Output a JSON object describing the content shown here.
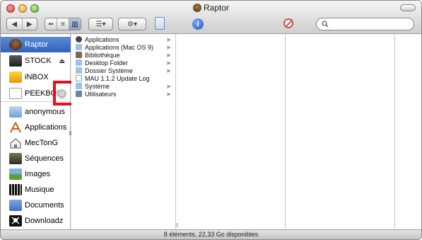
{
  "window": {
    "title": "Raptor"
  },
  "toolbar": {
    "back_icon": "back-arrow-icon",
    "forward_icon": "forward-arrow-icon",
    "view_icons": [
      "icon-view-icon",
      "list-view-icon",
      "column-view-icon"
    ],
    "arrange_icon": "arrange-menu-icon",
    "action_icon": "gear-action-icon",
    "search_value": ""
  },
  "sidebar": {
    "devices": [
      {
        "label": "Raptor",
        "selected": true
      },
      {
        "label": "STOCK",
        "eject": "⏏"
      },
      {
        "label": "iNBOX"
      },
      {
        "label": "PEEKBOX",
        "eject": "⊖"
      }
    ],
    "places": [
      {
        "label": "anonymous"
      },
      {
        "label": "Applications"
      },
      {
        "label": "MecTonG"
      },
      {
        "label": "Séquences"
      },
      {
        "label": "Images"
      },
      {
        "label": "Musique"
      },
      {
        "label": "Documents"
      },
      {
        "label": "Downloadz"
      }
    ]
  },
  "column1": {
    "items": [
      {
        "label": "Applications",
        "arrow": "▶"
      },
      {
        "label": "Applications (Mac OS 9)",
        "arrow": "▶"
      },
      {
        "label": "Bibliothèque",
        "arrow": "▶"
      },
      {
        "label": "Desktop Folder",
        "arrow": "▶"
      },
      {
        "label": "Dossier Système",
        "arrow": "▶"
      },
      {
        "label": "MAU 1.1.2 Update Log",
        "arrow": ""
      },
      {
        "label": "Système",
        "arrow": "▶"
      },
      {
        "label": "Utilisateurs",
        "arrow": "▶"
      }
    ]
  },
  "status": {
    "text": "8 éléments, 22,33 Go disponibles"
  },
  "colors": {
    "selection": "#3a6fc6",
    "highlight": "#e30f1f"
  }
}
